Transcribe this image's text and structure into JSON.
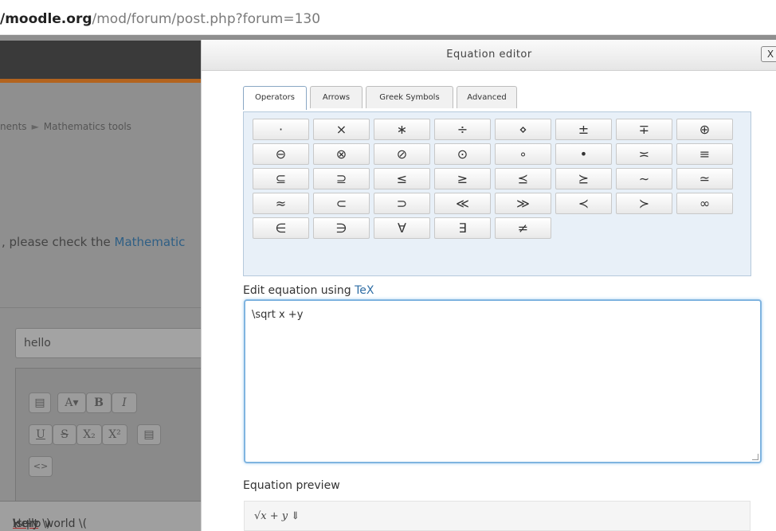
{
  "browser": {
    "url_host": "/moodle.org",
    "url_path": "/mod/forum/post.php?forum=130"
  },
  "background": {
    "breadcrumb": [
      "nents",
      "Mathematics tools"
    ],
    "breadcrumb_separator": "►",
    "notice_text": ", please check the ",
    "notice_link": "Mathematic",
    "subject_value": "hello",
    "toolbar_row1": [
      "▤",
      "A▾",
      "B",
      "I"
    ],
    "toolbar_row2": [
      "U",
      "S",
      "X₂",
      "X²",
      "▤"
    ],
    "toolbar_row3": [
      "<>"
    ],
    "message_prefix": "Hello world \\( ",
    "message_underlined": "\\sqrt",
    "message_suffix": " x +y \\)"
  },
  "dialog": {
    "title": "Equation editor",
    "close_label": "X",
    "tabs": [
      {
        "label": "Operators",
        "active": true
      },
      {
        "label": "Arrows",
        "active": false
      },
      {
        "label": "Greek Symbols",
        "active": false
      },
      {
        "label": "Advanced",
        "active": false
      }
    ],
    "symbols": [
      [
        "·",
        "×",
        "∗",
        "÷",
        "⋄",
        "±",
        "∓",
        "⊕"
      ],
      [
        "⊖",
        "⊗",
        "⊘",
        "⊙",
        "∘",
        "•",
        "≍",
        "≡"
      ],
      [
        "⊆",
        "⊇",
        "≤",
        "≥",
        "⪯",
        "⪰",
        "∼",
        "≃"
      ],
      [
        "≈",
        "⊂",
        "⊃",
        "≪",
        "≫",
        "≺",
        "≻",
        "∞"
      ],
      [
        "∈",
        "∋",
        "∀",
        "∃",
        "≠"
      ]
    ],
    "edit_label_prefix": "Edit equation using ",
    "edit_label_link": "TeX",
    "tex_value": "\\sqrt x +y",
    "preview_label": "Equation preview",
    "preview_rendered": "√x + y ⇓"
  },
  "colors": {
    "accent_link": "#2f6ea5",
    "focus_border": "#7fb4e0",
    "panel_bg": "#e8f0f8",
    "header_orange": "#b3641f"
  }
}
